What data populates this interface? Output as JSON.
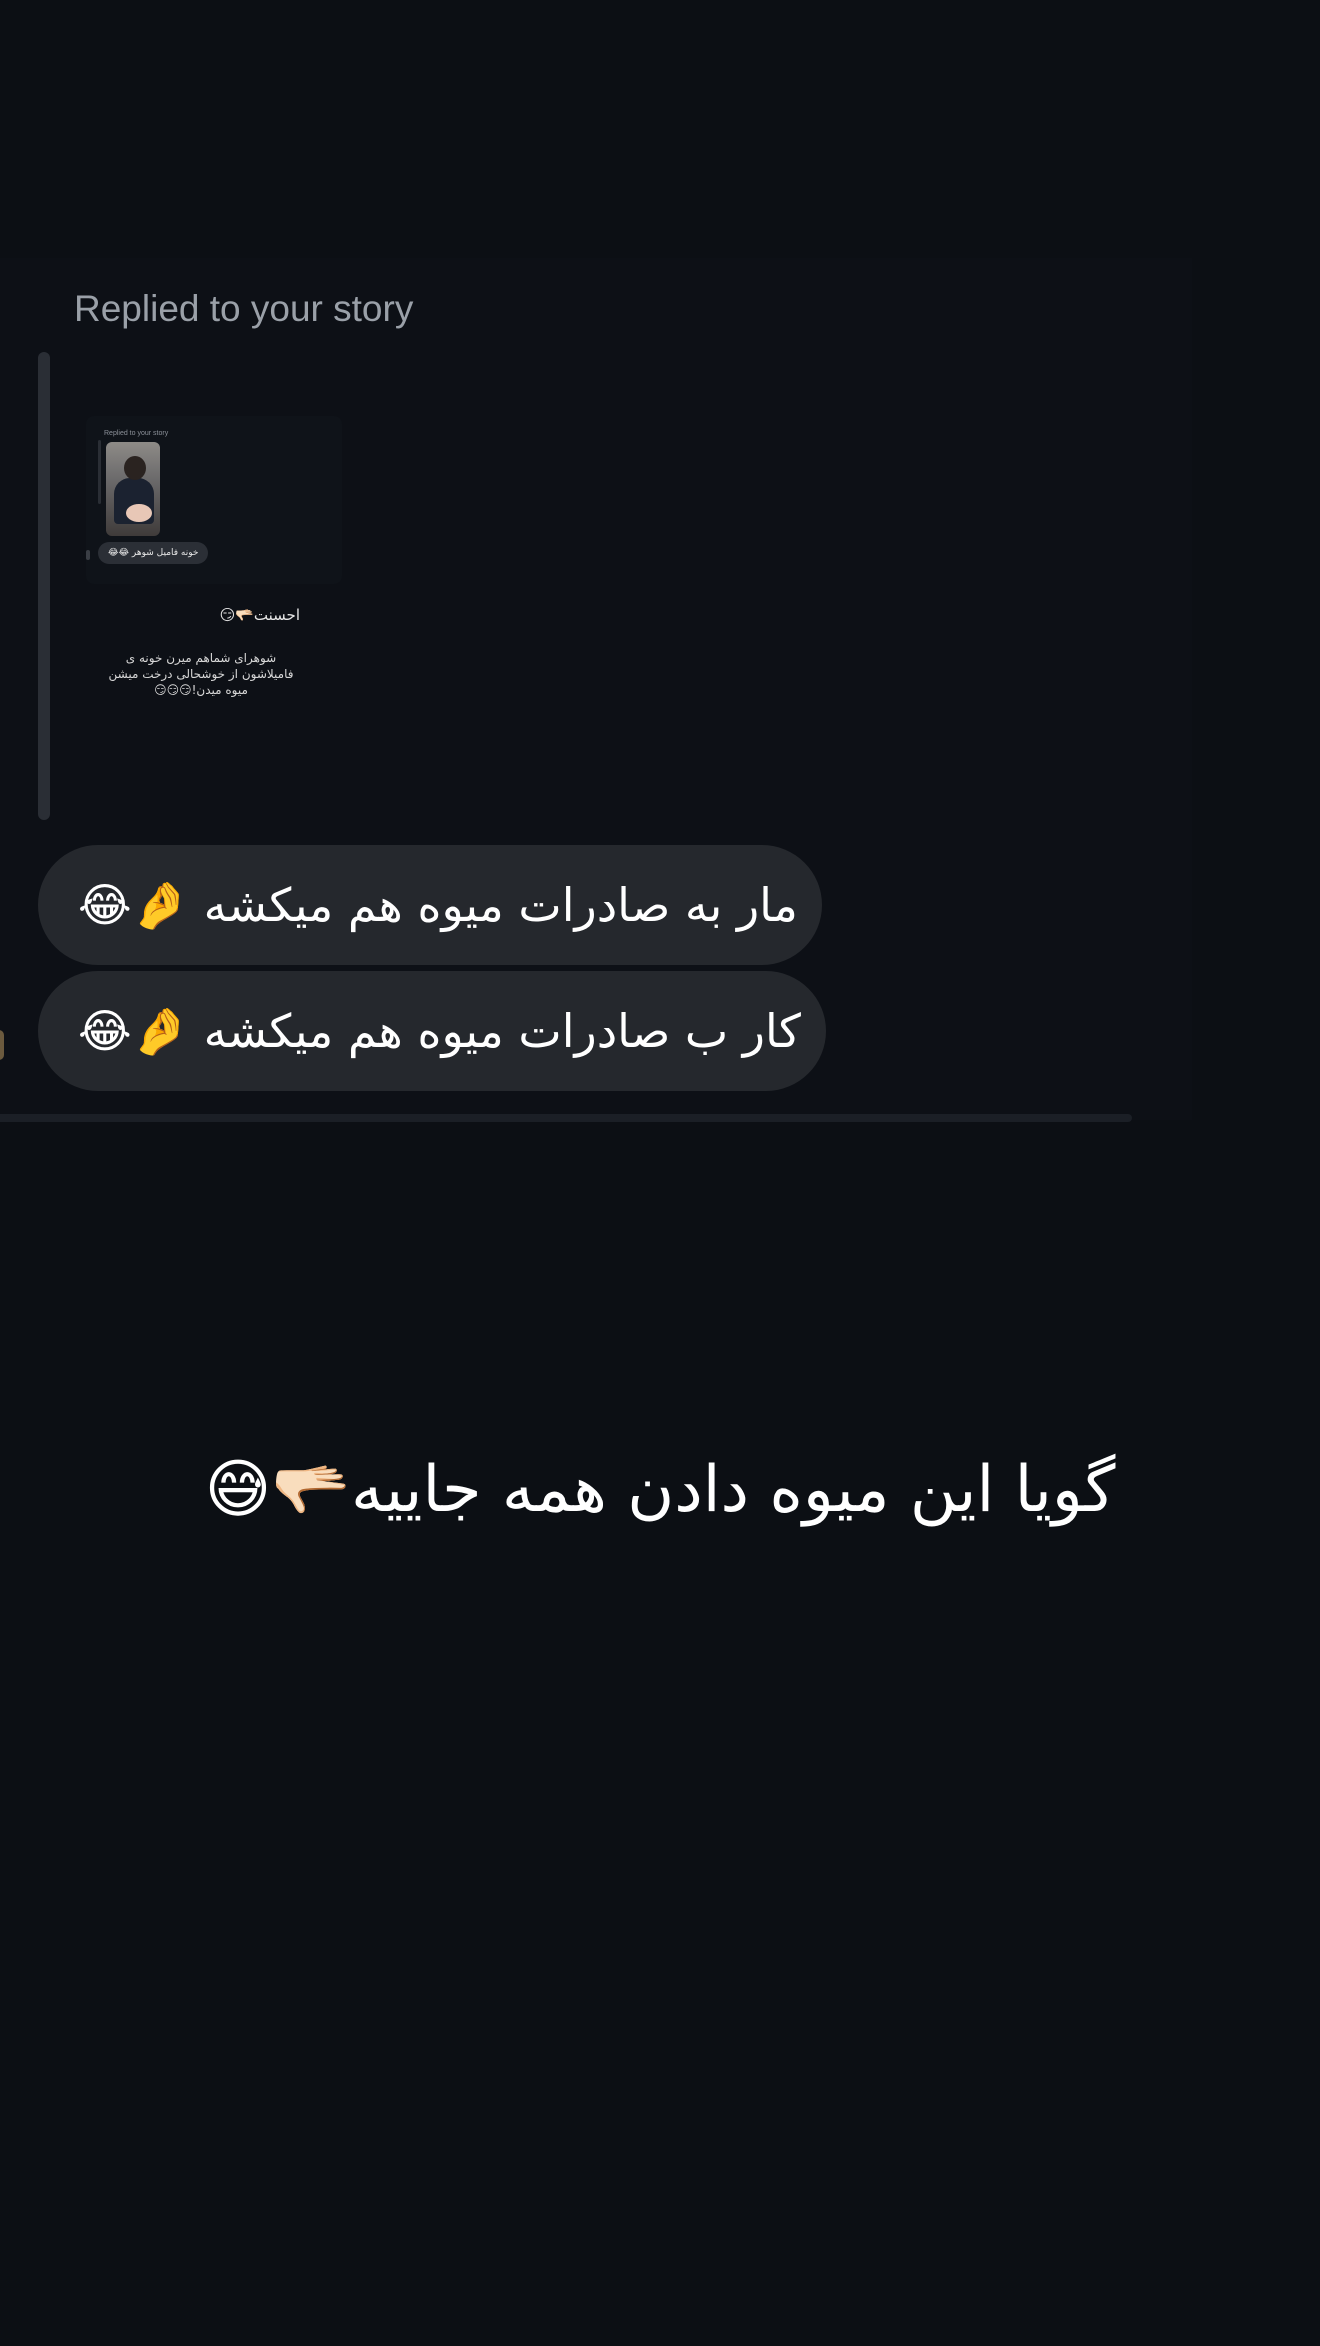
{
  "story": {
    "replied_label": "Replied to your story",
    "preview": {
      "replied_label": "Replied to your story",
      "pill_text": "خونه فامیل شوهر 😂😂",
      "line1": "احسنت🫳🏻😏",
      "line2": "شوهرای شماهم میرن خونه ی فامیلاشون از خوشحالی درخت میشن میوه میدن!😏😏😏"
    }
  },
  "messages": [
    {
      "text": "مار به صادرات میوه هم میکشه 🤌😂"
    },
    {
      "text": "کار ب صادرات میوه هم میکشه 🤌😂"
    }
  ],
  "caption": {
    "text": "گویا این میوه دادن همه جاییه🫳🏻😅"
  },
  "colors": {
    "background": "#0c0f14",
    "bubble": "#25282d",
    "muted_text": "#9aa0a8"
  }
}
